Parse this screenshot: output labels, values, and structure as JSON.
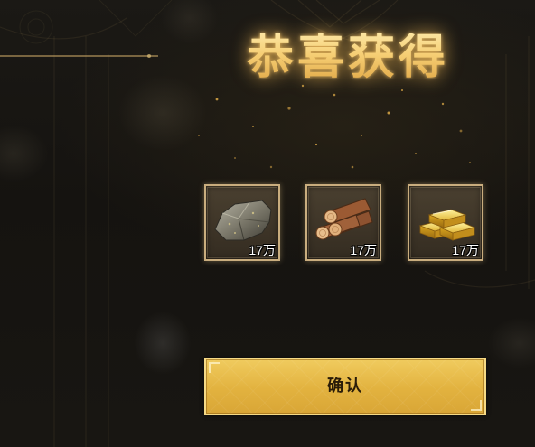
{
  "dialog": {
    "title": "恭喜获得"
  },
  "rewards": [
    {
      "icon": "stone-ore-icon",
      "quantity": "17万"
    },
    {
      "icon": "wood-logs-icon",
      "quantity": "17万"
    },
    {
      "icon": "gold-bars-icon",
      "quantity": "17万"
    }
  ],
  "confirm_button": {
    "label": "确认"
  },
  "colors": {
    "title_gold": "#f1c769",
    "button_gold": "#e2b23f",
    "slot_border": "#c9ad7e",
    "background": "#141210"
  }
}
